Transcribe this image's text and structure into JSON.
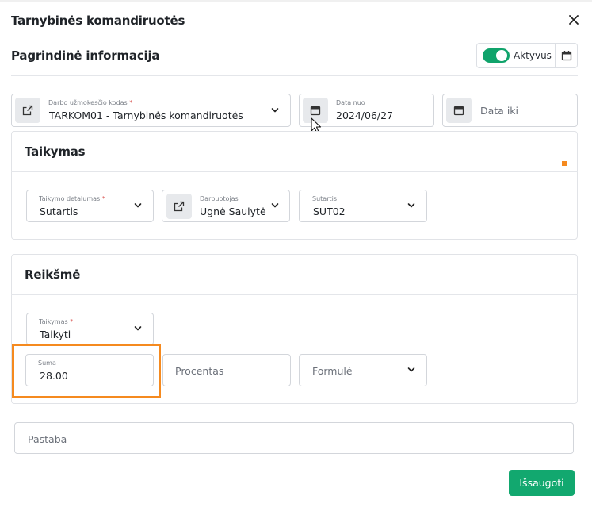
{
  "modal": {
    "title": "Tarnybinės komandiruotės"
  },
  "main_info": {
    "title": "Pagrindinė informacija",
    "active_label": "Aktyvus",
    "active_on": true
  },
  "work_code": {
    "label": "Darbo užmokesčio kodas",
    "required_mark": "*",
    "value": "TARKOM01 - Tarnybinės komandiruotės"
  },
  "date_from": {
    "label": "Data nuo",
    "value": "2024/06/27"
  },
  "date_to": {
    "placeholder": "Data iki"
  },
  "taikymas_section": {
    "title": "Taikymas",
    "detail": {
      "label": "Taikymo detalumas",
      "required_mark": "*",
      "value": "Sutartis"
    },
    "employee": {
      "label": "Darbuotojas",
      "value": "Ugnė Saulytė"
    },
    "contract": {
      "label": "Sutartis",
      "value": "SUT02"
    }
  },
  "value_section": {
    "title": "Reikšmė",
    "application": {
      "label": "Taikymas",
      "required_mark": "*",
      "value": "Taikyti"
    },
    "amount": {
      "label": "Suma",
      "value": "28.00"
    },
    "percent": {
      "placeholder": "Procentas"
    },
    "formula": {
      "placeholder": "Formulė"
    }
  },
  "note": {
    "placeholder": "Pastaba"
  },
  "actions": {
    "save_label": "Išsaugoti"
  },
  "colors": {
    "accent_green": "#12a86f",
    "highlight_orange": "#f58a1f"
  }
}
